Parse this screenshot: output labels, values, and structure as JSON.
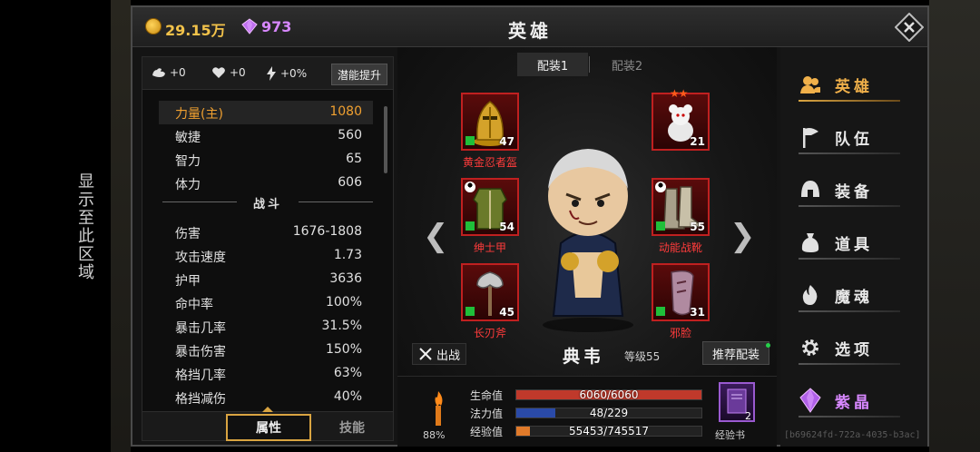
{
  "side_notice": "显示至此区域",
  "currency": {
    "gold": "29.15万",
    "gems": "973"
  },
  "window": {
    "title": "英雄",
    "close_icon": "close-icon"
  },
  "bonus": {
    "strength": "+0",
    "health": "+0",
    "speed": "+0%",
    "potential_button": "潜能提升"
  },
  "attributes": [
    {
      "key": "力量(主)",
      "value": "1080",
      "main": true
    },
    {
      "key": "敏捷",
      "value": "560"
    },
    {
      "key": "智力",
      "value": "65"
    },
    {
      "key": "体力",
      "value": "606"
    }
  ],
  "combat_header": "战斗",
  "combat": [
    {
      "key": "伤害",
      "value": "1676-1808"
    },
    {
      "key": "攻击速度",
      "value": "1.73"
    },
    {
      "key": "护甲",
      "value": "3636"
    },
    {
      "key": "命中率",
      "value": "100%"
    },
    {
      "key": "暴击几率",
      "value": "31.5%"
    },
    {
      "key": "暴击伤害",
      "value": "150%"
    },
    {
      "key": "格挡几率",
      "value": "63%"
    },
    {
      "key": "格挡减伤",
      "value": "40%"
    }
  ],
  "left_tabs": {
    "attributes": "属性",
    "skills": "技能"
  },
  "loadouts": {
    "tab1": "配装1",
    "tab2": "配装2"
  },
  "equipment": [
    {
      "name": "黄金忍者盔",
      "level": "47"
    },
    {
      "name": "",
      "level": "21",
      "stars": "★★"
    },
    {
      "name": "绅士甲",
      "level": "54"
    },
    {
      "name": "动能战靴",
      "level": "55"
    },
    {
      "name": "长刃斧",
      "level": "45"
    },
    {
      "name": "邪脸",
      "level": "31"
    }
  ],
  "hero": {
    "name": "典韦",
    "level": "等级55",
    "fight_button": "出战",
    "recommend_button": "推荐配装"
  },
  "status": {
    "morale": "88%",
    "hp_label": "生命值",
    "hp_text": "6060/6060",
    "hp_ratio": 1.0,
    "mp_label": "法力值",
    "mp_text": "48/229",
    "mp_ratio": 0.21,
    "xp_label": "经验值",
    "xp_text": "55453/745517",
    "xp_ratio": 0.074,
    "exp_book_label": "经验书",
    "exp_book_count": "2"
  },
  "menu": [
    {
      "label": "英雄",
      "icon": "heroes-icon"
    },
    {
      "label": "队伍",
      "icon": "flag-icon"
    },
    {
      "label": "装备",
      "icon": "helmet-icon"
    },
    {
      "label": "道具",
      "icon": "bag-icon"
    },
    {
      "label": "魔魂",
      "icon": "flame-icon"
    },
    {
      "label": "选项",
      "icon": "gear-icon"
    },
    {
      "label": "紫晶",
      "icon": "amethyst-icon"
    }
  ],
  "session_id": "[b69624fd-722a-4035-b3ac]",
  "colors": {
    "accent": "#d9a441",
    "hp": "#c0392b",
    "mp": "#2a4aa8",
    "xp": "#e07a2a",
    "gem": "#d888ff"
  }
}
